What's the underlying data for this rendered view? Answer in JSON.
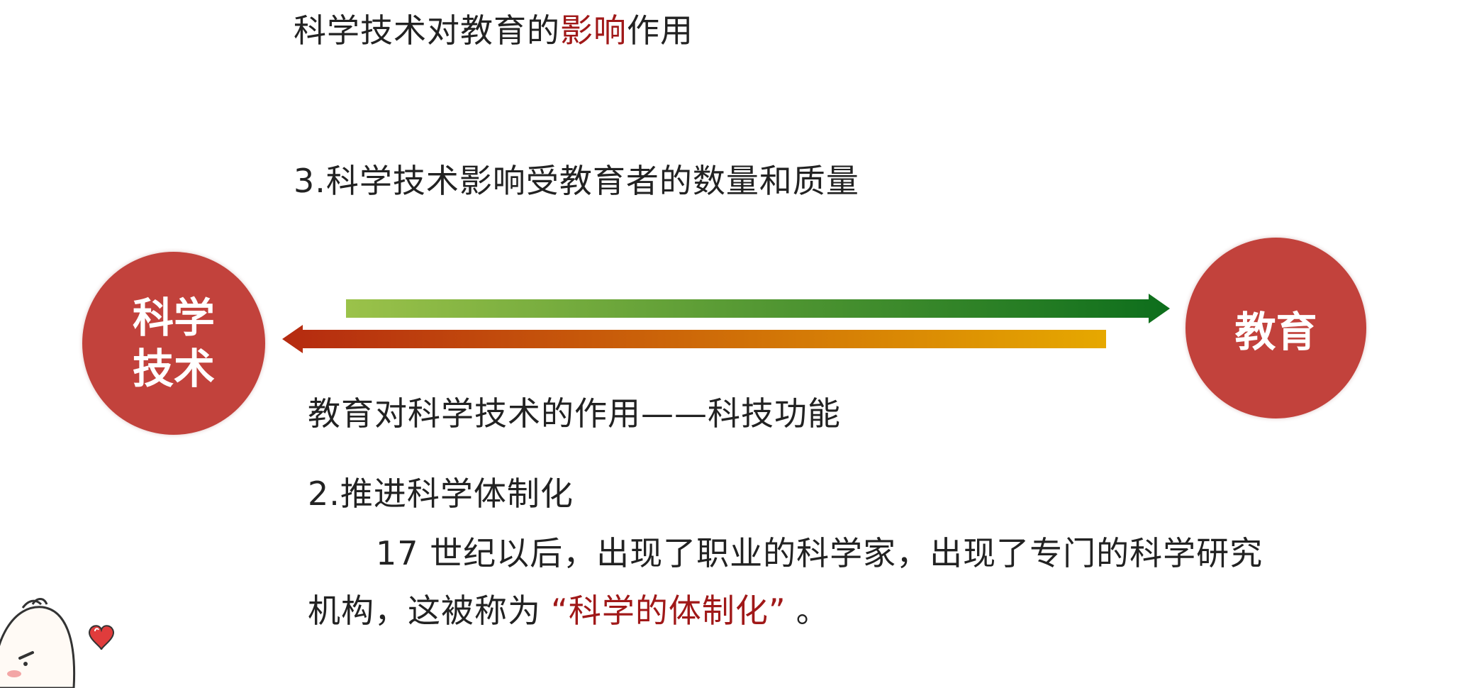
{
  "slide": {
    "title_prefix": "科学技术对教育的",
    "title_highlight": "影响",
    "title_suffix": "作用",
    "point3": "3.科学技术影响受教育者的数量和质量",
    "left_circle_line1": "科学",
    "left_circle_line2": "技术",
    "right_circle": "教育",
    "function_heading": "教育对科学技术的作用——科技功能",
    "point2": "2.推进科学体制化",
    "para_line1": "17 世纪以后，出现了职业的科学家，出现了专门的科学研究",
    "para_line2_prefix": "机构，这被称为",
    "para_quote": "“科学的体制化”",
    "para_line2_suffix": "。"
  },
  "colors": {
    "circle": "#c2423c",
    "highlight": "#a01818",
    "arrow_right_start": "#9bc24a",
    "arrow_right_end": "#0d6e1c",
    "arrow_left_start": "#b52a10",
    "arrow_left_end": "#e6a800"
  },
  "icons": {
    "mascot": "cartoon-face-icon",
    "heart": "heart-icon"
  }
}
